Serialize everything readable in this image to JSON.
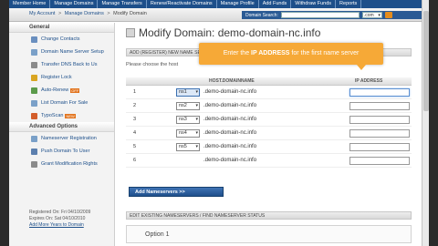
{
  "topnav": [
    "Member Home",
    "Manage Domains",
    "Manage Transfers",
    "Renew/Reactivate Domains",
    "Manage Profile",
    "Add Funds",
    "Withdraw Funds",
    "Reports"
  ],
  "breadcrumb": {
    "home": "My Account",
    "section": "Manage Domains",
    "current": "Modify Domain",
    "separator": ">"
  },
  "domain_search": {
    "label": "Domain Search:",
    "value": "",
    "select": ".com",
    "go": "Go"
  },
  "sidebar": {
    "general_title": "General",
    "general_items": [
      {
        "label": "Change Contacts",
        "color": "#6a8fbf"
      },
      {
        "label": "Domain Name Server Setup",
        "color": "#7aa0c8"
      },
      {
        "label": "Transfer DNS Back to Us",
        "color": "#8a8a8a"
      },
      {
        "label": "Register Lock",
        "color": "#d9a521"
      },
      {
        "label": "Auto-Renew",
        "color": "#5b9a4a",
        "badge": "OFF"
      },
      {
        "label": "List Domain For Sale",
        "color": "#7aa0c8"
      },
      {
        "label": "TypoScan",
        "color": "#d35d2a",
        "badge": "NEW"
      }
    ],
    "advanced_title": "Advanced Options",
    "advanced_items": [
      {
        "label": "Nameserver Registration",
        "color": "#7aa0c8"
      },
      {
        "label": "Push Domain To User",
        "color": "#5b7fae"
      },
      {
        "label": "Grant Modification Rights",
        "color": "#8a8a8a"
      }
    ],
    "registered": "Registered On: Fri 04/10/2009",
    "expires": "Expires On: Sat 04/10/2010",
    "add_years": "Add More Years to Domain"
  },
  "main": {
    "title": "Modify Domain: demo-domain-nc.info",
    "section1": "ADD (REGISTER) NEW NAME SERVERS",
    "choose_text": "Please choose the host",
    "col_host": "HOST.DOMAINNAME",
    "col_ip": "IP ADDRESS",
    "rows": [
      {
        "num": "1",
        "sel": "ns1",
        "domain": ".demo-domain-nc.info"
      },
      {
        "num": "2",
        "sel": "ns2",
        "domain": ".demo-domain-nc.info"
      },
      {
        "num": "3",
        "sel": "ns3",
        "domain": ".demo-domain-nc.info"
      },
      {
        "num": "4",
        "sel": "ns4",
        "domain": ".demo-domain-nc.info"
      },
      {
        "num": "5",
        "sel": "ns5",
        "domain": ".demo-domain-nc.info"
      },
      {
        "num": "6",
        "sel": "",
        "domain": ".demo-domain-nc.info"
      }
    ],
    "add_button": "Add Nameservers >>",
    "section2": "EDIT EXISTING NAMESERVERS / FIND NAMESERVER STATUS",
    "option1": "Option 1"
  },
  "tooltip": {
    "prefix": "Enter the ",
    "emph": "IP ADDRESS",
    "suffix": " for the first name server"
  }
}
